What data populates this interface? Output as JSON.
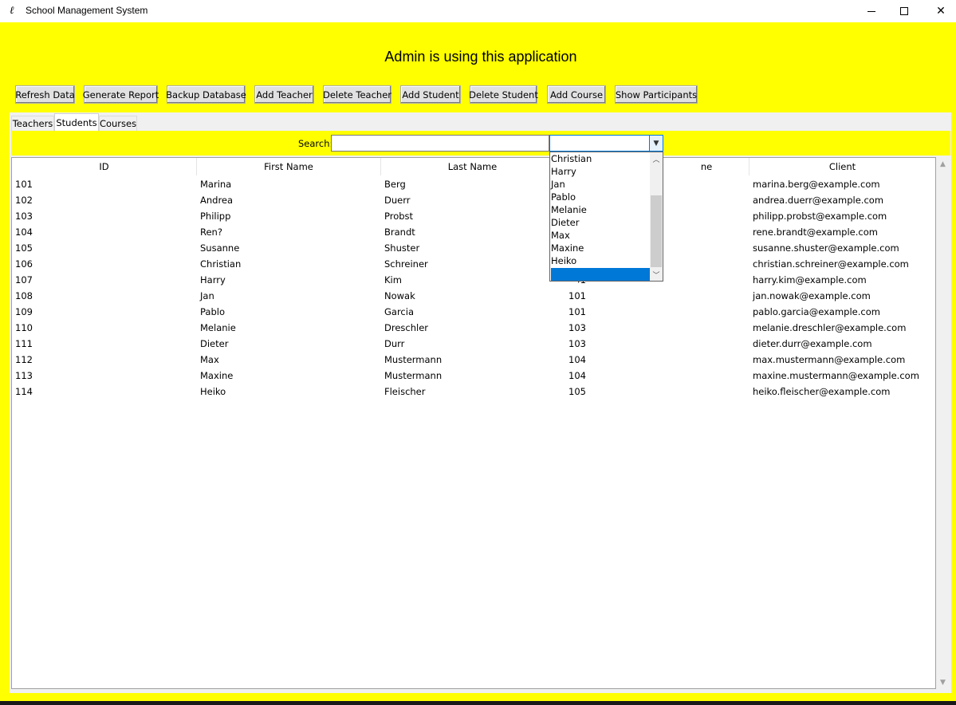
{
  "window": {
    "title": "School Management System",
    "controls": [
      "minimize",
      "maximize",
      "close"
    ]
  },
  "header": {
    "title": "Admin is using this application"
  },
  "toolbar": {
    "buttons": [
      "Refresh Data",
      "Generate Report",
      "Backup Database",
      "Add Teacher",
      "Delete Teacher",
      "Add Student",
      "Delete Student",
      "Add Course",
      "Show Participants"
    ]
  },
  "tabs": {
    "items": [
      "Teachers",
      "Students",
      "Courses"
    ],
    "active": "Students"
  },
  "search": {
    "label": "Search:",
    "value": "",
    "combo_value": ""
  },
  "table": {
    "columns": [
      "ID",
      "First Name",
      "Last Name",
      "",
      "Client"
    ],
    "rows": [
      [
        "101",
        "Marina",
        "Berg",
        "",
        "marina.berg@example.com"
      ],
      [
        "102",
        "Andrea",
        "Duerr",
        "",
        "andrea.duerr@example.com"
      ],
      [
        "103",
        "Philipp",
        "Probst",
        "",
        "philipp.probst@example.com"
      ],
      [
        "104",
        "Ren?",
        "Brandt",
        "",
        "rene.brandt@example.com"
      ],
      [
        "105",
        "Susanne",
        "Shuster",
        "",
        "susanne.shuster@example.com"
      ],
      [
        "106",
        "Christian",
        "Schreiner",
        "",
        "christian.schreiner@example.com"
      ],
      [
        "107",
        "Harry",
        "Kim",
        "",
        "harry.kim@example.com"
      ],
      [
        "108",
        "Jan",
        "Nowak",
        "101",
        "jan.nowak@example.com"
      ],
      [
        "109",
        "Pablo",
        "Garcia",
        "101",
        "pablo.garcia@example.com"
      ],
      [
        "110",
        "Melanie",
        "Dreschler",
        "103",
        "melanie.dreschler@example.com"
      ],
      [
        "111",
        "Dieter",
        "Durr",
        "103",
        "dieter.durr@example.com"
      ],
      [
        "112",
        "Max",
        "Mustermann",
        "104",
        "max.mustermann@example.com"
      ],
      [
        "113",
        "Maxine",
        "Mustermann",
        "104",
        "maxine.mustermann@example.com"
      ],
      [
        "114",
        "Heiko",
        "Fleischer",
        "105",
        "heiko.fleischer@example.com"
      ]
    ],
    "partial_header_fragment": "ne",
    "partial_row_fragment": "101"
  },
  "dropdown": {
    "options": [
      "Christian",
      "Harry",
      "Jan",
      "Pablo",
      "Melanie",
      "Dieter",
      "Max",
      "Maxine",
      "Heiko",
      ""
    ],
    "selected_index": 9
  },
  "colors": {
    "background": "#ffff00",
    "selection": "#0078d7"
  }
}
